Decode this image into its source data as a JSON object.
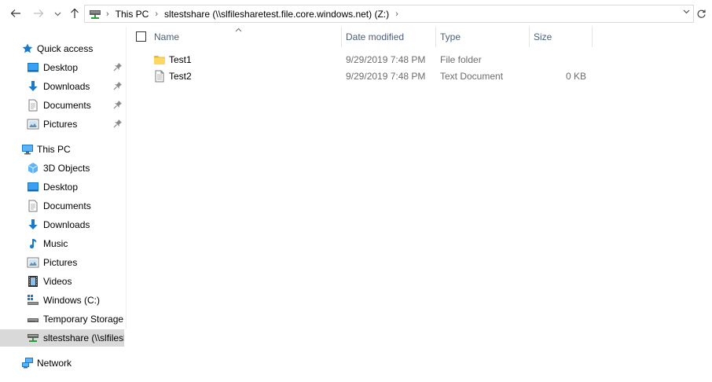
{
  "address": {
    "crumbs": [
      "This PC",
      "sltestshare (\\\\slfilesharetest.file.core.windows.net) (Z:)"
    ]
  },
  "nav": {
    "quick_access": {
      "label": "Quick access",
      "items": [
        {
          "label": "Desktop",
          "icon": "desktop-icon",
          "pinned": true
        },
        {
          "label": "Downloads",
          "icon": "downloads-icon",
          "pinned": true
        },
        {
          "label": "Documents",
          "icon": "documents-icon",
          "pinned": true
        },
        {
          "label": "Pictures",
          "icon": "pictures-icon",
          "pinned": true
        }
      ]
    },
    "this_pc": {
      "label": "This PC",
      "items": [
        {
          "label": "3D Objects",
          "icon": "3d-objects-icon"
        },
        {
          "label": "Desktop",
          "icon": "desktop-icon"
        },
        {
          "label": "Documents",
          "icon": "documents-icon"
        },
        {
          "label": "Downloads",
          "icon": "downloads-icon"
        },
        {
          "label": "Music",
          "icon": "music-icon"
        },
        {
          "label": "Pictures",
          "icon": "pictures-icon"
        },
        {
          "label": "Videos",
          "icon": "videos-icon"
        },
        {
          "label": "Windows (C:)",
          "icon": "windows-drive-icon"
        },
        {
          "label": "Temporary Storage",
          "icon": "drive-icon"
        },
        {
          "label": "sltestshare (\\\\slfilesl",
          "icon": "network-drive-icon",
          "selected": true
        }
      ]
    },
    "network": {
      "label": "Network",
      "icon": "network-icon"
    }
  },
  "columns": {
    "name": "Name",
    "date": "Date modified",
    "type": "Type",
    "size": "Size"
  },
  "files": [
    {
      "name": "Test1",
      "date": "9/29/2019 7:48 PM",
      "type": "File folder",
      "size": "",
      "icon": "folder-icon"
    },
    {
      "name": "Test2",
      "date": "9/29/2019 7:48 PM",
      "type": "Text Document",
      "size": "0 KB",
      "icon": "text-document-icon"
    }
  ],
  "colors": {
    "header_text": "#4c607a",
    "secondary_text": "#6d6d6d",
    "selected_bg": "#d9d9d9",
    "folder_yellow": "#ffd75e",
    "accent_blue": "#1979ca"
  }
}
